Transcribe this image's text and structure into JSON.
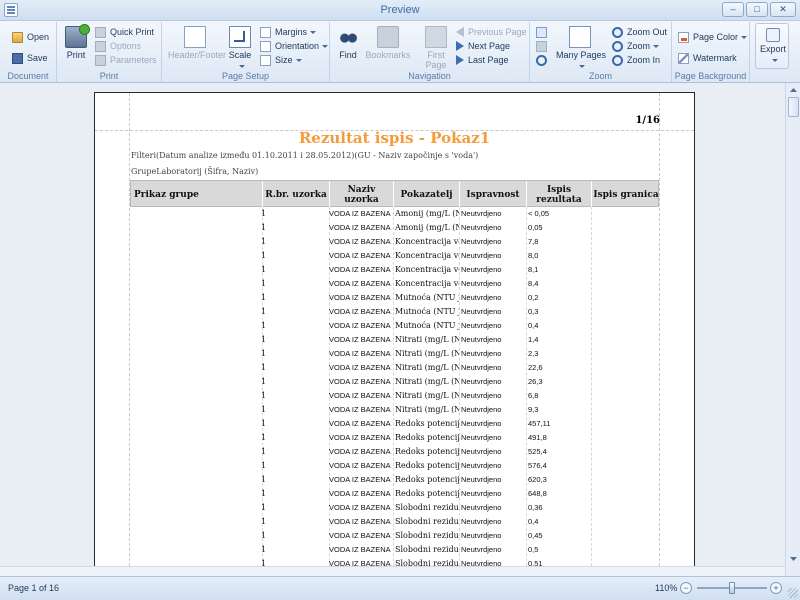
{
  "window": {
    "title": "Preview",
    "buttons": {
      "minimize": "–",
      "maximize": "□",
      "close": "✕"
    }
  },
  "ribbon": {
    "groups": {
      "document": "Document",
      "print": "Print",
      "page_setup": "Page Setup",
      "navigation": "Navigation",
      "zoom": "Zoom",
      "page_background": "Page Background"
    },
    "document": {
      "open": "Open",
      "save": "Save"
    },
    "print": {
      "print": "Print",
      "quick_print": "Quick Print",
      "options": "Options",
      "parameters": "Parameters"
    },
    "page_setup": {
      "header_footer": "Header/Footer",
      "scale": "Scale",
      "margins": "Margins",
      "orientation": "Orientation",
      "size": "Size"
    },
    "navigation": {
      "find": "Find",
      "bookmarks": "Bookmarks",
      "first_page_1": "First",
      "first_page_2": "Page",
      "previous_page": "Previous Page",
      "next_page": "Next Page",
      "last_page": "Last Page"
    },
    "zoom": {
      "many_pages": "Many Pages",
      "zoom_out": "Zoom Out",
      "zoom": "Zoom",
      "zoom_in": "Zoom In"
    },
    "page_background": {
      "page_color": "Page Color",
      "watermark": "Watermark"
    },
    "export": {
      "label": "Export"
    }
  },
  "report": {
    "page_indicator": "1/16",
    "title": "Rezultat ispis - Pokaz1",
    "filter_text": "Filteri(Datum analize između 01.10.2011 i 28.05.2012)(GU - Naziv započinje s 'voda')",
    "group_text": "GrupeLaboratorij (Šifra, Naziv)",
    "columns": [
      "Prikaz grupe",
      "R.br. uzorka",
      "Naziv uzorka",
      "Pokazatelj",
      "Ispravnost",
      "Ispis rezultata",
      "Ispis granica"
    ],
    "rows": [
      {
        "rbr": "1",
        "naziv": "VODA IZ BAZENA",
        "pokazatelj": "Amonij (mg/L (N",
        "ispravnost": "Neutvrdjeno",
        "rezultat": "< 0,05"
      },
      {
        "rbr": "1",
        "naziv": "VODA IZ BAZENA",
        "pokazatelj": "Amonij (mg/L (N",
        "ispravnost": "Neutvrdjeno",
        "rezultat": "0,05"
      },
      {
        "rbr": "1",
        "naziv": "VODA IZ BAZENA",
        "pokazatelj": "Koncentracija vod",
        "ispravnost": "Neutvrdjeno",
        "rezultat": "7,8"
      },
      {
        "rbr": "1",
        "naziv": "VODA IZ BAZENA",
        "pokazatelj": "Koncentracija vod",
        "ispravnost": "Neutvrdjeno",
        "rezultat": "8,0"
      },
      {
        "rbr": "1",
        "naziv": "VODA IZ BAZENA",
        "pokazatelj": "Koncentracija vod",
        "ispravnost": "Neutvrdjeno",
        "rezultat": "8,1"
      },
      {
        "rbr": "1",
        "naziv": "VODA IZ BAZENA",
        "pokazatelj": "Koncentracija vod",
        "ispravnost": "Neutvrdjeno",
        "rezultat": "8,4"
      },
      {
        "rbr": "1",
        "naziv": "VODA IZ BAZENA",
        "pokazatelj": "Mutnoća (NTU jed",
        "ispravnost": "Neutvrdjeno",
        "rezultat": "0,2"
      },
      {
        "rbr": "1",
        "naziv": "VODA IZ BAZENA",
        "pokazatelj": "Mutnoća (NTU jed",
        "ispravnost": "Neutvrdjeno",
        "rezultat": "0,3"
      },
      {
        "rbr": "1",
        "naziv": "VODA IZ BAZENA",
        "pokazatelj": "Mutnoća (NTU jed",
        "ispravnost": "Neutvrdjeno",
        "rezultat": "0,4"
      },
      {
        "rbr": "1",
        "naziv": "VODA IZ BAZENA",
        "pokazatelj": "Nitrati (mg/L (NO",
        "ispravnost": "Neutvrdjeno",
        "rezultat": "1,4"
      },
      {
        "rbr": "1",
        "naziv": "VODA IZ BAZENA",
        "pokazatelj": "Nitrati (mg/L (NO",
        "ispravnost": "Neutvrdjeno",
        "rezultat": "2,3"
      },
      {
        "rbr": "1",
        "naziv": "VODA IZ BAZENA",
        "pokazatelj": "Nitrati (mg/L (NO",
        "ispravnost": "Neutvrdjeno",
        "rezultat": "22,6"
      },
      {
        "rbr": "1",
        "naziv": "VODA IZ BAZENA",
        "pokazatelj": "Nitrati (mg/L (NO",
        "ispravnost": "Neutvrdjeno",
        "rezultat": "26,3"
      },
      {
        "rbr": "1",
        "naziv": "VODA IZ BAZENA",
        "pokazatelj": "Nitrati (mg/L (NO",
        "ispravnost": "Neutvrdjeno",
        "rezultat": "6,8"
      },
      {
        "rbr": "1",
        "naziv": "VODA IZ BAZENA",
        "pokazatelj": "Nitrati (mg/L (NO",
        "ispravnost": "Neutvrdjeno",
        "rezultat": "9,3"
      },
      {
        "rbr": "1",
        "naziv": "VODA IZ BAZENA",
        "pokazatelj": "Redoks potencijal",
        "ispravnost": "Neutvrdjeno",
        "rezultat": "457,11"
      },
      {
        "rbr": "1",
        "naziv": "VODA IZ BAZENA",
        "pokazatelj": "Redoks potencijal",
        "ispravnost": "Neutvrdjeno",
        "rezultat": "491,8"
      },
      {
        "rbr": "1",
        "naziv": "VODA IZ BAZENA",
        "pokazatelj": "Redoks potencijal",
        "ispravnost": "Neutvrdjeno",
        "rezultat": "525,4"
      },
      {
        "rbr": "1",
        "naziv": "VODA IZ BAZENA",
        "pokazatelj": "Redoks potencijal",
        "ispravnost": "Neutvrdjeno",
        "rezultat": "576,4"
      },
      {
        "rbr": "1",
        "naziv": "VODA IZ BAZENA",
        "pokazatelj": "Redoks potencijal",
        "ispravnost": "Neutvrdjeno",
        "rezultat": "620,3"
      },
      {
        "rbr": "1",
        "naziv": "VODA IZ BAZENA",
        "pokazatelj": "Redoks potencijal",
        "ispravnost": "Neutvrdjeno",
        "rezultat": "648,8"
      },
      {
        "rbr": "1",
        "naziv": "VODA IZ BAZENA",
        "pokazatelj": "Slobodni rezidual",
        "ispravnost": "Neutvrdjeno",
        "rezultat": "0,36"
      },
      {
        "rbr": "1",
        "naziv": "VODA IZ BAZENA",
        "pokazatelj": "Slobodni rezidual",
        "ispravnost": "Neutvrdjeno",
        "rezultat": "0,4"
      },
      {
        "rbr": "1",
        "naziv": "VODA IZ BAZENA",
        "pokazatelj": "Slobodni rezidual",
        "ispravnost": "Neutvrdjeno",
        "rezultat": "0,45"
      },
      {
        "rbr": "1",
        "naziv": "VODA IZ BAZENA",
        "pokazatelj": "Slobodni rezidual",
        "ispravnost": "Neutvrdjeno",
        "rezultat": "0,5"
      },
      {
        "rbr": "1",
        "naziv": "VODA IZ BAZENA",
        "pokazatelj": "Slobodni rezidual",
        "ispravnost": "Neutvrdjeno",
        "rezultat": "0,51"
      }
    ]
  },
  "status": {
    "page_text": "Page 1 of 16",
    "zoom_percent": "110%",
    "zoom_level": 1.1
  },
  "icons": {
    "open": "folder-icon",
    "save": "floppy-icon",
    "print": "printer-icon",
    "find": "binoculars-icon",
    "next": "arrow-right-icon",
    "zoom": "magnifier-icon"
  },
  "colors": {
    "title_orange": "#f59b3b",
    "header_gray": "#d9d9d9",
    "ribbon_blue": "#1e395b"
  }
}
